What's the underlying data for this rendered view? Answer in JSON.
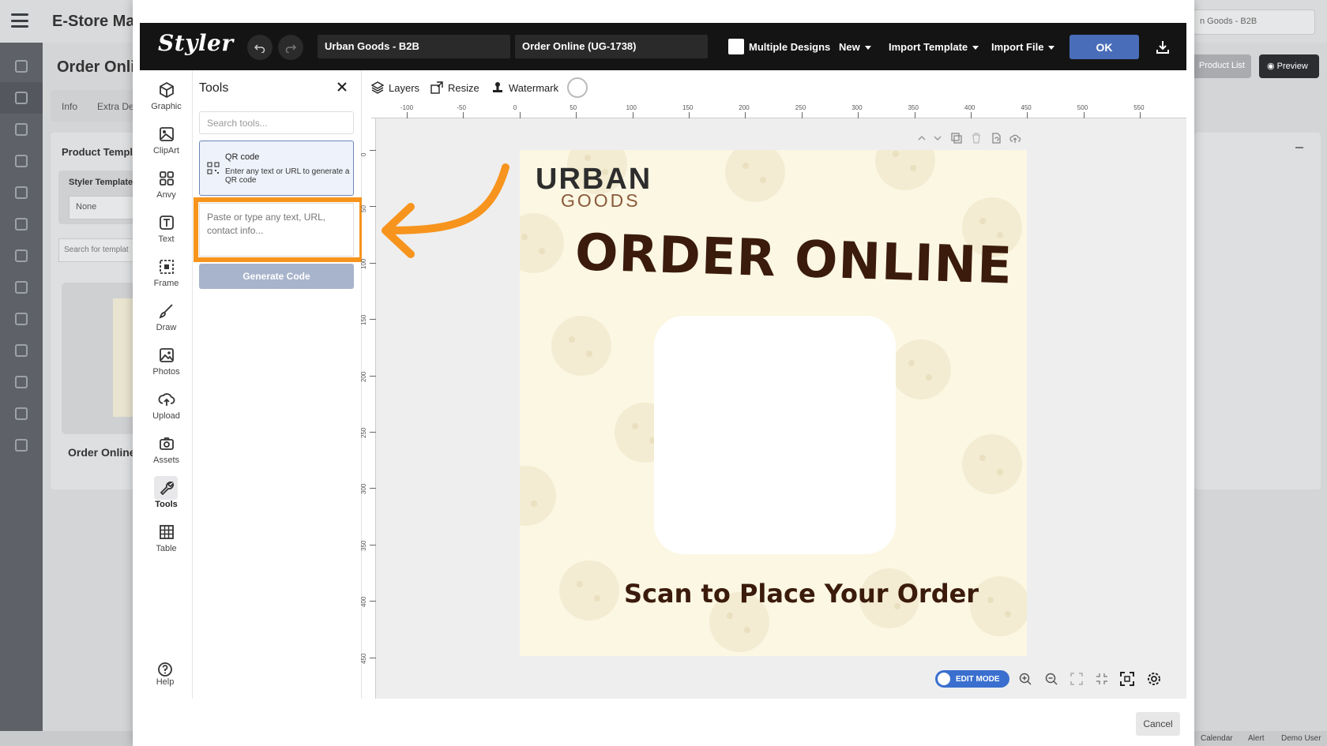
{
  "background_app": {
    "title": "E-Store Mar",
    "page_title": "Order Onli",
    "tabs": [
      "Info",
      "Extra De"
    ],
    "card_title": "Product Templa",
    "styler_template_label": "Styler Template",
    "styler_template_value": "None",
    "search_placeholder": "Search for templat",
    "thumb_label": "Order Online",
    "store_select": "n Goods - B2B",
    "product_list_button": "Product List",
    "preview_button": "Preview",
    "footer": [
      "Calendar",
      "Alert",
      "Demo User"
    ]
  },
  "editor": {
    "logo": "Styler",
    "store_field": "Urban Goods - B2B",
    "design_field": "Order Online (UG-1738)",
    "multiple_designs_label": "Multiple Designs",
    "multiple_designs_checked": false,
    "menus": [
      "New",
      "Import Template",
      "Import File"
    ],
    "ok_label": "OK",
    "cancel_label": "Cancel"
  },
  "rail": {
    "items": [
      "Graphic",
      "ClipArt",
      "Anvy",
      "Text",
      "Frame",
      "Draw",
      "Photos",
      "Upload",
      "Assets",
      "Tools",
      "Table"
    ],
    "active": "Tools",
    "help_label": "Help"
  },
  "tools_panel": {
    "title": "Tools",
    "search_placeholder": "Search tools...",
    "qr": {
      "title": "QR code",
      "description": "Enter any text or URL to generate a QR code",
      "input_placeholder": "Paste or type any text, URL, contact info...",
      "generate_label": "Generate Code"
    }
  },
  "canvas_toolbar": {
    "layers": "Layers",
    "resize": "Resize",
    "watermark": "Watermark"
  },
  "rulers": {
    "horizontal": [
      "-100",
      "-50",
      "0",
      "50",
      "100",
      "150",
      "200",
      "250",
      "300",
      "350",
      "400",
      "450",
      "500",
      "550"
    ],
    "vertical": [
      "0",
      "50",
      "100",
      "150",
      "200",
      "250",
      "300",
      "350",
      "400",
      "450"
    ]
  },
  "design": {
    "brand_top": "URBAN",
    "brand_bottom": "GOODS",
    "headline": "ORDER ONLINE",
    "subline": "Scan to Place Your Order",
    "background_color": "#fbf7e3",
    "text_color": "#3b1b0b"
  },
  "bottom_controls": {
    "edit_mode_label": "EDIT MODE",
    "edit_mode_on": true
  },
  "colors": {
    "accent_highlight": "#f7941d",
    "primary_button": "#4a6db9",
    "topbar": "#141414"
  }
}
